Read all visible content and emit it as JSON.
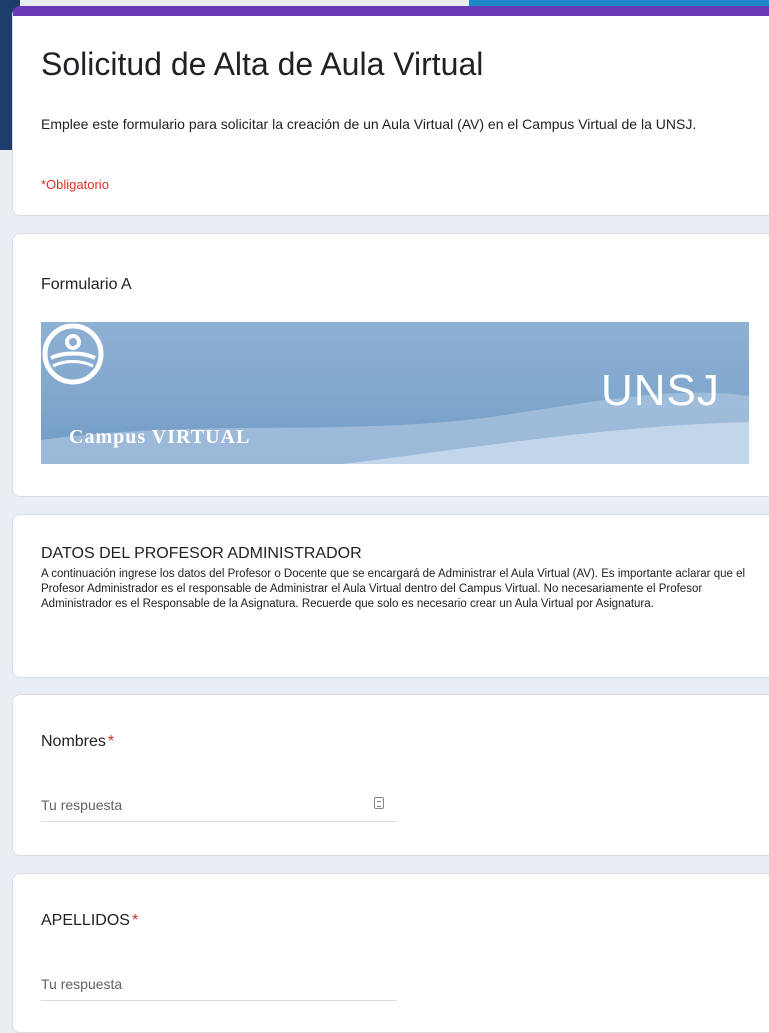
{
  "form": {
    "title": "Solicitud de Alta de Aula Virtual",
    "description": "Emplee este formulario para solicitar la creación de un Aula Virtual (AV) en el Campus Virtual de la UNSJ.",
    "required_note": "*Obligatorio",
    "accent_color": "#673ab7"
  },
  "banner": {
    "title": "Formulario A",
    "image_caption": "Campus VIRTUAL",
    "logo_text": "UNSJ"
  },
  "section": {
    "title": "DATOS DEL PROFESOR ADMINISTRADOR",
    "body": "A continuación ingrese los datos del Profesor o Docente que se encargará de Administrar el Aula Virtual (AV). Es importante aclarar que el Profesor Administrador es el responsable de Administrar el Aula Virtual dentro del Campus Virtual. No necesariamente el Profesor Administrador es el Responsable de la Asignatura. Recuerde que solo es necesario crear un Aula Virtual por Asignatura."
  },
  "questions": [
    {
      "label": "Nombres",
      "required_mark": "*",
      "placeholder": "Tu respuesta"
    },
    {
      "label": "APELLIDOS",
      "required_mark": "*",
      "placeholder": "Tu respuesta"
    }
  ]
}
